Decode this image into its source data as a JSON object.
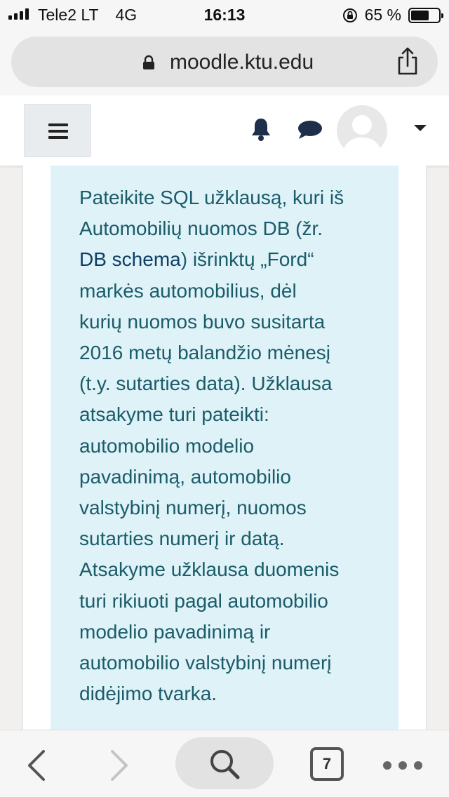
{
  "status_bar": {
    "carrier": "Tele2 LT",
    "network": "4G",
    "time": "16:13",
    "battery_percent": "65 %",
    "battery_level": 0.65
  },
  "browser": {
    "url": "moodle.ktu.edu",
    "open_tabs": "7"
  },
  "question": {
    "lines": [
      {
        "text": "Pateikite SQL užklausą, kuri iš"
      },
      {
        "text": "Automobilių nuomos DB (žr."
      },
      {
        "link": "DB schema",
        "after": ") išrinktų „Ford“"
      },
      {
        "text": "markės automobilius, dėl"
      },
      {
        "text": "kurių nuomos buvo susitarta"
      },
      {
        "text": "2016 metų balandžio mėnesį"
      },
      {
        "text": "(t.y. sutarties data). Užklausa"
      },
      {
        "text": "atsakyme turi pateikti:"
      },
      {
        "text": "automobilio modelio"
      },
      {
        "text": "pavadinimą, automobilio"
      },
      {
        "text": "valstybinį numerį, nuomos"
      },
      {
        "text": "sutarties numerį ir datą."
      },
      {
        "text": "Atsakyme užklausa duomenis"
      },
      {
        "text": "turi rikiuoti pagal automobilio"
      },
      {
        "text": "modelio pavadinimą ir"
      },
      {
        "text": "automobilio valstybinį numerį"
      },
      {
        "text": "didėjimo tvarka."
      }
    ]
  },
  "colors": {
    "question_bg": "#def2f8",
    "question_text": "#1a5c68",
    "link": "#0f3f66"
  }
}
